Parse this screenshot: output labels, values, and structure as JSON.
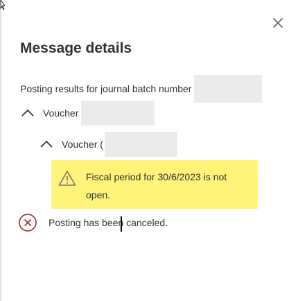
{
  "panel": {
    "title": "Message details",
    "close_icon": "close-icon"
  },
  "summary": {
    "label": "Posting results for journal batch number"
  },
  "groups": [
    {
      "label": "Voucher",
      "icon": "chevron-up-icon",
      "expanded": true
    },
    {
      "label": "Voucher (",
      "icon": "chevron-up-icon",
      "expanded": true
    }
  ],
  "warning": {
    "icon": "warning-triangle-icon",
    "text": "Fiscal period for 30/6/2023 is not open.",
    "background": "#fff37a"
  },
  "error": {
    "icon": "error-circle-icon",
    "text": "Posting has been canceled.",
    "color": "#a4262c"
  }
}
